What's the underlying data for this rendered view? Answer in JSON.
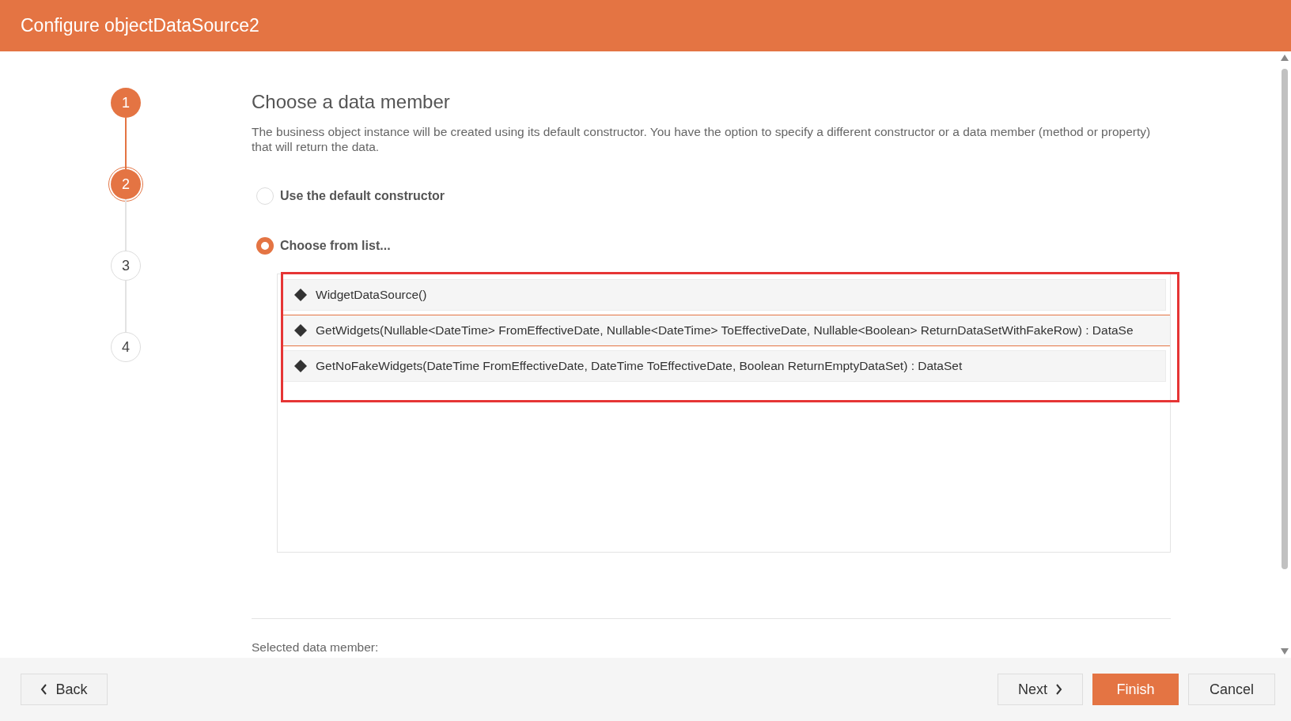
{
  "window": {
    "title": "Configure objectDataSource2"
  },
  "steps": [
    {
      "label": "1",
      "done": true,
      "current": false
    },
    {
      "label": "2",
      "done": false,
      "current": true
    },
    {
      "label": "3",
      "done": false,
      "current": false
    },
    {
      "label": "4",
      "done": false,
      "current": false
    }
  ],
  "page": {
    "heading": "Choose a data member",
    "description": "The business object instance will be created using its default constructor. You have the option to specify a different constructor or a data member (method or property) that will return the data.",
    "options": [
      {
        "label": "Use the default constructor",
        "selected": false
      },
      {
        "label": "Choose from list...",
        "selected": true
      }
    ],
    "members": [
      {
        "label": "WidgetDataSource()",
        "selected": false
      },
      {
        "label": "GetWidgets(Nullable<DateTime> FromEffectiveDate, Nullable<DateTime> ToEffectiveDate, Nullable<Boolean> ReturnDataSetWithFakeRow) : DataSe",
        "selected": true
      },
      {
        "label": "GetNoFakeWidgets(DateTime FromEffectiveDate, DateTime ToEffectiveDate, Boolean ReturnEmptyDataSet) : DataSet",
        "selected": false
      }
    ],
    "selected_member_label": "Selected data member:"
  },
  "buttons": [
    {
      "label": "Back",
      "kind": "back"
    },
    {
      "label": "Next",
      "kind": "next"
    },
    {
      "label": "Finish",
      "kind": "primary"
    },
    {
      "label": "Cancel",
      "kind": "plain"
    }
  ]
}
